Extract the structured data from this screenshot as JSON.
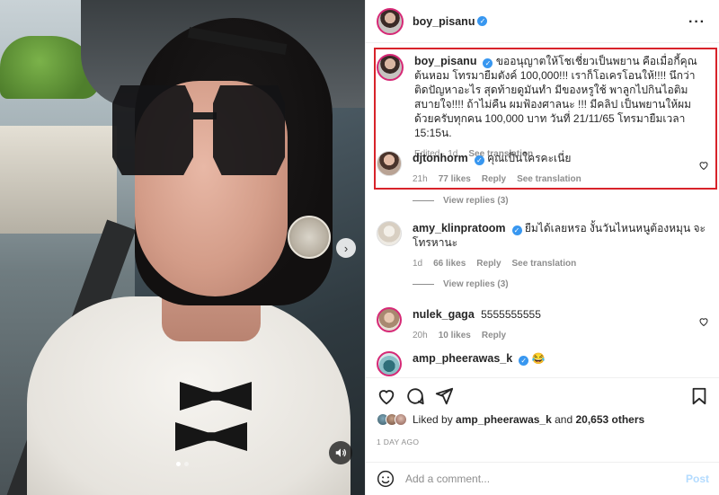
{
  "post": {
    "author": "boy_pisanu",
    "more_icon": "more-horizontal-icon",
    "caption": {
      "username": "boy_pisanu",
      "text": "ขออนุญาตให้โชเชี่ยวเป็นพยาน คือเมื่อกี้คุณต้นหอม โทรมายืมตังค์ 100,000!!! เราก็โอเครโอนให้!!!! นึกว่าติดปัญหาอะไร สุดท้ายดูมันทำ มีของหรูใช้ พาลูกไปกินไอติม สบายใจ!!!! ถ้าไม่คืน ผมฟ้องศาลนะ !!! มีคลิป เป็นพยานให้ผมด้วยครับทุกคน 100,000 บาท วันที่ 21/11/65 โทรมายืมเวลา 15:15น.",
      "meta_time": "Edited · 1d",
      "translate": "See translation"
    }
  },
  "comments": [
    {
      "username": "djtonhorm",
      "text": "คุณเป็นใครคะเนี่ย",
      "time": "21h",
      "likes": "77 likes",
      "reply": "Reply",
      "translate": "See translation",
      "replies": "View replies (3)"
    },
    {
      "username": "amy_klinpratoom",
      "text": "ยืมได้เลยหรอ งั้นวันไหนหนูต้องหมุน จะโทรหานะ",
      "time": "1d",
      "likes": "66 likes",
      "reply": "Reply",
      "translate": "See translation",
      "replies": "View replies (3)"
    },
    {
      "username": "nulek_gaga",
      "text": "5555555555",
      "time": "20h",
      "likes": "10 likes",
      "reply": "Reply"
    },
    {
      "username": "amp_pheerawas_k",
      "text": "😂"
    }
  ],
  "likes": {
    "prefix": "Liked by ",
    "user": "amp_pheerawas_k",
    "middle": " and ",
    "others": "20,653 others"
  },
  "date": "1 DAY AGO",
  "add_comment": {
    "placeholder": "Add a comment...",
    "post": "Post"
  },
  "colors": {
    "highlight": "#d8232a",
    "verified": "#3897f0",
    "post_button": "#b3dbff"
  }
}
